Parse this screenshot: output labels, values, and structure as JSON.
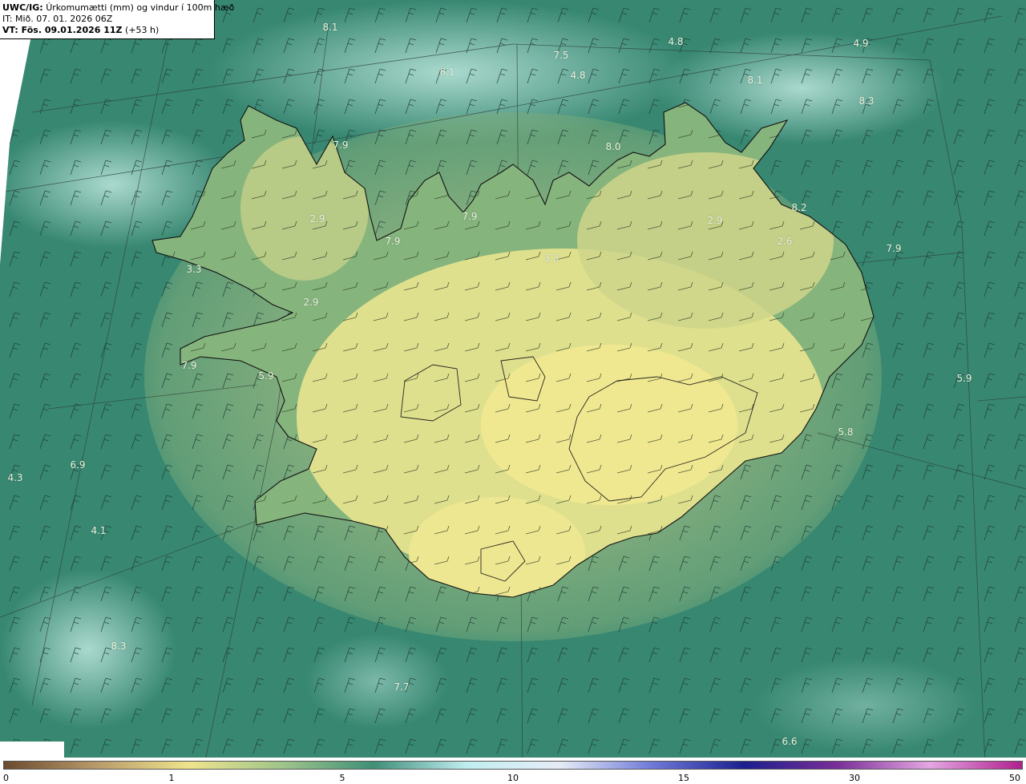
{
  "header": {
    "model": "UWC/IG:",
    "title": "Úrkomumætti (mm) og vindur í 100m hæð",
    "init_time": "IT: Mið. 07. 01. 2026 06Z",
    "valid_label": "VT: Fös. 09.01.2026 11Z",
    "lead_time": "(+53 h)"
  },
  "map_values": [
    {
      "id": "v1",
      "text": "8.1"
    },
    {
      "id": "v2",
      "text": "4.8"
    },
    {
      "id": "v3",
      "text": "7.5"
    },
    {
      "id": "v4",
      "text": "4.9"
    },
    {
      "id": "v5",
      "text": "8.1"
    },
    {
      "id": "v6",
      "text": "4.8"
    },
    {
      "id": "v7",
      "text": "8.1"
    },
    {
      "id": "v8",
      "text": "8.3"
    },
    {
      "id": "v9",
      "text": "7.9"
    },
    {
      "id": "v10",
      "text": "8.0"
    },
    {
      "id": "v11",
      "text": "2.9"
    },
    {
      "id": "v12",
      "text": "7.9"
    },
    {
      "id": "v13",
      "text": "2.9"
    },
    {
      "id": "v14",
      "text": "8.2"
    },
    {
      "id": "v15",
      "text": "2.6"
    },
    {
      "id": "v16",
      "text": "7.9"
    },
    {
      "id": "v17",
      "text": "3.3"
    },
    {
      "id": "v18",
      "text": "3.3"
    },
    {
      "id": "v19",
      "text": "7.9"
    },
    {
      "id": "v20",
      "text": "2.9"
    },
    {
      "id": "v21",
      "text": "7.9"
    },
    {
      "id": "v22",
      "text": "5.9"
    },
    {
      "id": "v23",
      "text": "5.9"
    },
    {
      "id": "v24",
      "text": "5.8"
    },
    {
      "id": "v25",
      "text": "6.9"
    },
    {
      "id": "v26",
      "text": "4.3"
    },
    {
      "id": "v27",
      "text": "4.1"
    },
    {
      "id": "v28",
      "text": "8.3"
    },
    {
      "id": "v29",
      "text": "7.7"
    },
    {
      "id": "v30",
      "text": "6.6"
    }
  ],
  "colorbar": {
    "ticks": [
      {
        "id": "t0",
        "label": "0"
      },
      {
        "id": "t1",
        "label": "1"
      },
      {
        "id": "t5",
        "label": "5"
      },
      {
        "id": "t10",
        "label": "10"
      },
      {
        "id": "t15",
        "label": "15"
      },
      {
        "id": "t30",
        "label": "30"
      },
      {
        "id": "t50",
        "label": "50"
      }
    ],
    "colors": [
      "#6b4a2e",
      "#b89a6a",
      "#efe48c",
      "#9fc58a",
      "#3f8f78",
      "#bfeef0",
      "#e6ecf6",
      "#6f7ad8",
      "#1b1f8e",
      "#7a2e98",
      "#e4a6e2",
      "#b0208e"
    ]
  },
  "colors": {
    "sea": "#3a8c74",
    "land_low": "#7fb27c",
    "land_high": "#e8e48c",
    "coast": "#111111"
  }
}
